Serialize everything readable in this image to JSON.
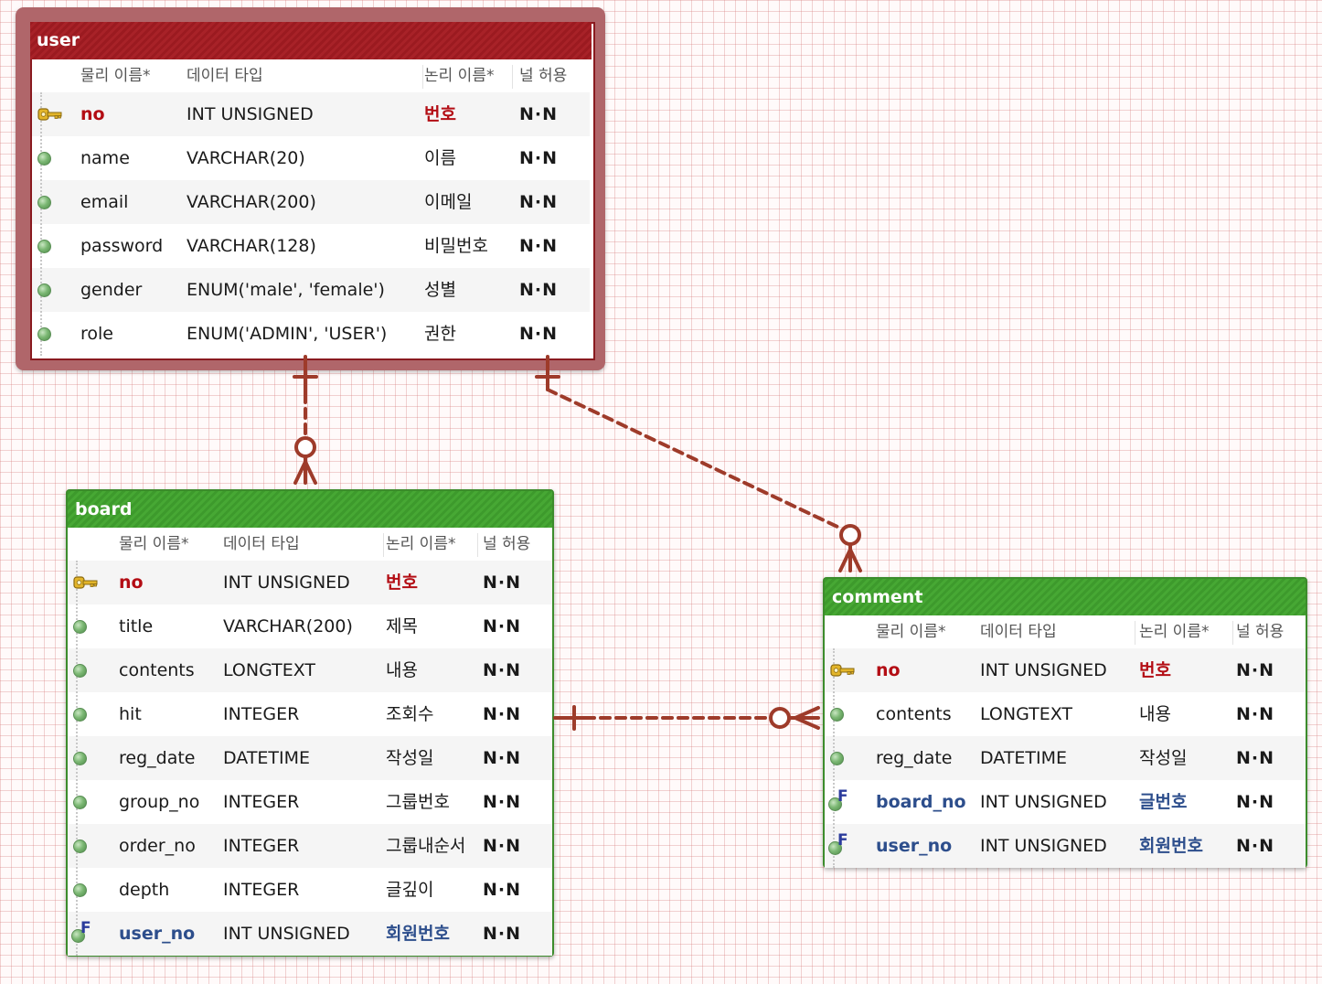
{
  "columns_header": {
    "physical": "물리 이름*",
    "datatype": "데이터 타입",
    "logical": "논리 이름*",
    "nullable": "널 허용"
  },
  "theme": {
    "user": "#9b1a20",
    "board": "#3f9a2e",
    "comment": "#3f9a2e",
    "relationship": "#9e3b2a",
    "pk": "#b30d14",
    "fk": "#2d4e8c"
  },
  "entities": {
    "user": {
      "title": "user",
      "rows": [
        {
          "kind": "pk",
          "icon": "primary-key-icon",
          "name": "no",
          "type": "INT UNSIGNED",
          "logical": "번호",
          "nn": "N·N"
        },
        {
          "kind": "col",
          "icon": "column-icon",
          "name": "name",
          "type": "VARCHAR(20)",
          "logical": "이름",
          "nn": "N·N"
        },
        {
          "kind": "col",
          "icon": "column-icon",
          "name": "email",
          "type": "VARCHAR(200)",
          "logical": "이메일",
          "nn": "N·N"
        },
        {
          "kind": "col",
          "icon": "column-icon",
          "name": "password",
          "type": "VARCHAR(128)",
          "logical": "비밀번호",
          "nn": "N·N"
        },
        {
          "kind": "col",
          "icon": "column-icon",
          "name": "gender",
          "type": "ENUM('male', 'female')",
          "logical": "성별",
          "nn": "N·N"
        },
        {
          "kind": "col",
          "icon": "column-icon",
          "name": "role",
          "type": "ENUM('ADMIN', 'USER')",
          "logical": "권한",
          "nn": "N·N"
        }
      ]
    },
    "board": {
      "title": "board",
      "rows": [
        {
          "kind": "pk",
          "icon": "primary-key-icon",
          "name": "no",
          "type": "INT UNSIGNED",
          "logical": "번호",
          "nn": "N·N"
        },
        {
          "kind": "col",
          "icon": "column-icon",
          "name": "title",
          "type": "VARCHAR(200)",
          "logical": "제목",
          "nn": "N·N"
        },
        {
          "kind": "col",
          "icon": "column-icon",
          "name": "contents",
          "type": "LONGTEXT",
          "logical": "내용",
          "nn": "N·N"
        },
        {
          "kind": "col",
          "icon": "column-icon",
          "name": "hit",
          "type": "INTEGER",
          "logical": "조회수",
          "nn": "N·N"
        },
        {
          "kind": "col",
          "icon": "column-icon",
          "name": "reg_date",
          "type": "DATETIME",
          "logical": "작성일",
          "nn": "N·N"
        },
        {
          "kind": "col",
          "icon": "column-icon",
          "name": "group_no",
          "type": "INTEGER",
          "logical": "그룹번호",
          "nn": "N·N"
        },
        {
          "kind": "col",
          "icon": "column-icon",
          "name": "order_no",
          "type": "INTEGER",
          "logical": "그룹내순서",
          "nn": "N·N"
        },
        {
          "kind": "col",
          "icon": "column-icon",
          "name": "depth",
          "type": "INTEGER",
          "logical": "글깊이",
          "nn": "N·N"
        },
        {
          "kind": "fk",
          "icon": "foreign-key-icon",
          "name": "user_no",
          "type": "INT UNSIGNED",
          "logical": "회원번호",
          "nn": "N·N"
        }
      ]
    },
    "comment": {
      "title": "comment",
      "rows": [
        {
          "kind": "pk",
          "icon": "primary-key-icon",
          "name": "no",
          "type": "INT UNSIGNED",
          "logical": "번호",
          "nn": "N·N"
        },
        {
          "kind": "col",
          "icon": "column-icon",
          "name": "contents",
          "type": "LONGTEXT",
          "logical": "내용",
          "nn": "N·N"
        },
        {
          "kind": "col",
          "icon": "column-icon",
          "name": "reg_date",
          "type": "DATETIME",
          "logical": "작성일",
          "nn": "N·N"
        },
        {
          "kind": "fk",
          "icon": "foreign-key-icon",
          "name": "board_no",
          "type": "INT UNSIGNED",
          "logical": "글번호",
          "nn": "N·N"
        },
        {
          "kind": "fk",
          "icon": "foreign-key-icon",
          "name": "user_no",
          "type": "INT UNSIGNED",
          "logical": "회원번호",
          "nn": "N·N"
        }
      ]
    }
  },
  "relationships": [
    {
      "from": "user",
      "to": "board",
      "from_cardinality": "one",
      "to_cardinality": "zero-or-many",
      "style": "dashed"
    },
    {
      "from": "user",
      "to": "comment",
      "from_cardinality": "one",
      "to_cardinality": "zero-or-many",
      "style": "dashed"
    },
    {
      "from": "board",
      "to": "comment",
      "from_cardinality": "one",
      "to_cardinality": "zero-or-many",
      "style": "dashed"
    }
  ]
}
